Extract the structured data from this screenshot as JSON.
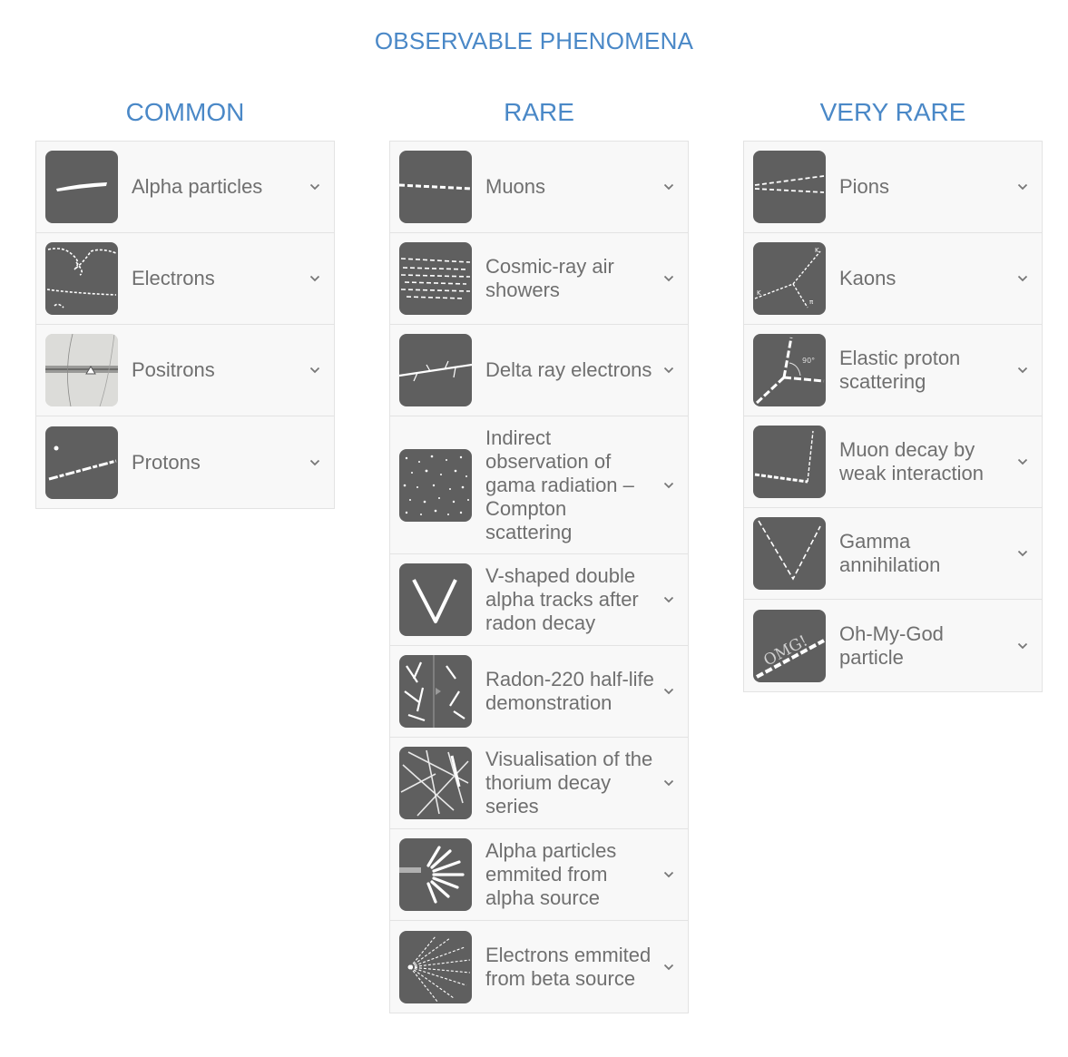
{
  "page_title": "OBSERVABLE PHENOMENA",
  "columns": {
    "common": {
      "heading": "COMMON",
      "items": [
        {
          "label": "Alpha particles",
          "icon": "alpha-track-icon"
        },
        {
          "label": "Electrons",
          "icon": "electron-track-icon"
        },
        {
          "label": "Positrons",
          "icon": "positron-photo-icon"
        },
        {
          "label": "Protons",
          "icon": "proton-track-icon"
        }
      ]
    },
    "rare": {
      "heading": "RARE",
      "items": [
        {
          "label": "Muons",
          "icon": "muon-track-icon"
        },
        {
          "label": "Cosmic-ray air showers",
          "icon": "air-shower-icon"
        },
        {
          "label": "Delta ray electrons",
          "icon": "delta-ray-icon"
        },
        {
          "label": "Indirect observation of gama radiation – Compton scattering",
          "icon": "compton-scatter-icon"
        },
        {
          "label": "V-shaped double alpha tracks after radon decay",
          "icon": "v-alpha-tracks-icon"
        },
        {
          "label": "Radon-220 half-life demonstration",
          "icon": "radon-halflife-icon"
        },
        {
          "label": "Visualisation of the thorium decay series",
          "icon": "thorium-decay-icon"
        },
        {
          "label": "Alpha particles emmited from alpha source",
          "icon": "alpha-source-icon"
        },
        {
          "label": "Electrons emmited from beta source",
          "icon": "beta-source-icon"
        }
      ]
    },
    "very_rare": {
      "heading": "VERY RARE",
      "items": [
        {
          "label": "Pions",
          "icon": "pion-track-icon"
        },
        {
          "label": "Kaons",
          "icon": "kaon-decay-icon"
        },
        {
          "label": "Elastic proton scattering",
          "icon": "proton-scatter-icon"
        },
        {
          "label": "Muon decay by weak interaction",
          "icon": "muon-decay-icon"
        },
        {
          "label": "Gamma annihilation",
          "icon": "gamma-annihilation-icon"
        },
        {
          "label": "Oh-My-God particle",
          "icon": "omg-particle-icon"
        }
      ],
      "thumb_text": {
        "kaon_k1": "K",
        "kaon_k2": "K",
        "kaon_pi": "π",
        "proton_angle": "90°",
        "omg": "OMG!"
      }
    }
  },
  "colors": {
    "accent": "#4a88c7",
    "thumb_bg": "#5f5f5f",
    "text": "#6f6f6f",
    "panel_bg": "#f8f8f8",
    "border": "#e3e3e3"
  }
}
